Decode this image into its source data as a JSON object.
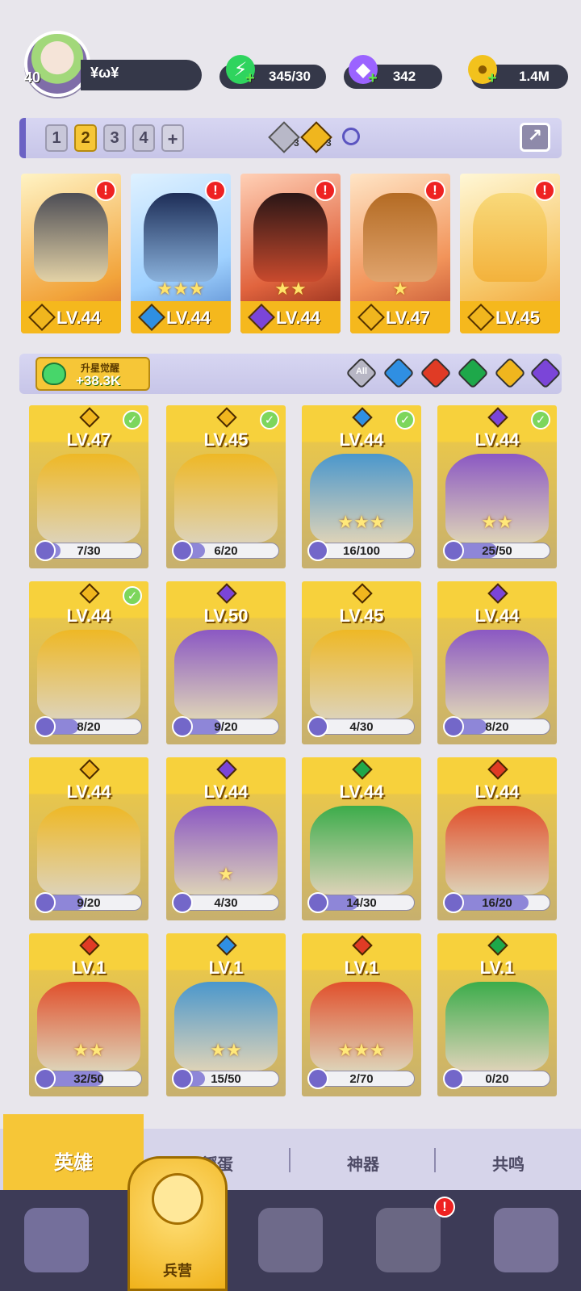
{
  "player": {
    "level": "40",
    "name": "¥ω¥"
  },
  "resources": {
    "energy": {
      "icon": "lightning-icon",
      "value": "345/30"
    },
    "gems": {
      "icon": "diamond-icon",
      "value": "342"
    },
    "gold": {
      "icon": "coin-icon",
      "value": "1.4M"
    }
  },
  "team": {
    "tabs": [
      "1",
      "2",
      "3",
      "4"
    ],
    "active_tab": "2",
    "add_label": "+",
    "summary": [
      {
        "icon": "silver-element-icon",
        "count": "3"
      },
      {
        "icon": "gold-element-icon",
        "count": "3"
      }
    ]
  },
  "lineup": [
    {
      "level": "LV.44",
      "element": "gold",
      "stars": "",
      "alert": "!"
    },
    {
      "level": "LV.44",
      "element": "blue",
      "stars": "★★★",
      "alert": "!"
    },
    {
      "level": "LV.44",
      "element": "purple",
      "stars": "★★",
      "alert": "!"
    },
    {
      "level": "LV.47",
      "element": "gold",
      "stars": "★",
      "alert": "!"
    },
    {
      "level": "LV.45",
      "element": "gold",
      "stars": "",
      "alert": "!"
    }
  ],
  "power": {
    "label": "升星觉醒",
    "value": "+38.3K"
  },
  "filters": {
    "all_label": "All"
  },
  "heroes": [
    {
      "level": "LV.47",
      "frag": "7/30",
      "check": true,
      "element": "gold",
      "stars": ""
    },
    {
      "level": "LV.45",
      "frag": "6/20",
      "check": true,
      "element": "gold",
      "stars": ""
    },
    {
      "level": "LV.44",
      "frag": "16/100",
      "check": true,
      "element": "blue",
      "stars": "★★★"
    },
    {
      "level": "LV.44",
      "frag": "25/50",
      "check": true,
      "element": "purple",
      "stars": "★★"
    },
    {
      "level": "LV.44",
      "frag": "8/20",
      "check": true,
      "element": "gold",
      "stars": ""
    },
    {
      "level": "LV.50",
      "frag": "9/20",
      "check": false,
      "element": "purple",
      "stars": ""
    },
    {
      "level": "LV.45",
      "frag": "4/30",
      "check": false,
      "element": "gold",
      "stars": ""
    },
    {
      "level": "LV.44",
      "frag": "8/20",
      "check": false,
      "element": "purple",
      "stars": ""
    },
    {
      "level": "LV.44",
      "frag": "9/20",
      "check": false,
      "element": "gold",
      "stars": ""
    },
    {
      "level": "LV.44",
      "frag": "4/30",
      "check": false,
      "element": "purple",
      "stars": "★"
    },
    {
      "level": "LV.44",
      "frag": "14/30",
      "check": false,
      "element": "green",
      "stars": ""
    },
    {
      "level": "LV.44",
      "frag": "16/20",
      "check": false,
      "element": "red",
      "stars": ""
    },
    {
      "level": "LV.1",
      "frag": "32/50",
      "check": false,
      "element": "red",
      "stars": "★★"
    },
    {
      "level": "LV.1",
      "frag": "15/50",
      "check": false,
      "element": "blue",
      "stars": "★★"
    },
    {
      "level": "LV.1",
      "frag": "2/70",
      "check": false,
      "element": "red",
      "stars": "★★★"
    },
    {
      "level": "LV.1",
      "frag": "0/20",
      "check": false,
      "element": "green",
      "stars": ""
    }
  ],
  "tabs": [
    "英雄",
    "孵蛋",
    "神器",
    "共鸣"
  ],
  "nav": {
    "active_label": "兵营",
    "badge": "!"
  },
  "colors": {
    "gold": "#f0b61e",
    "blue": "#2f8fe2",
    "purple": "#7b45d8",
    "green": "#1ea84a",
    "red": "#e03b25",
    "accent": "#f6c637",
    "nav_bg": "#3d3b57"
  }
}
